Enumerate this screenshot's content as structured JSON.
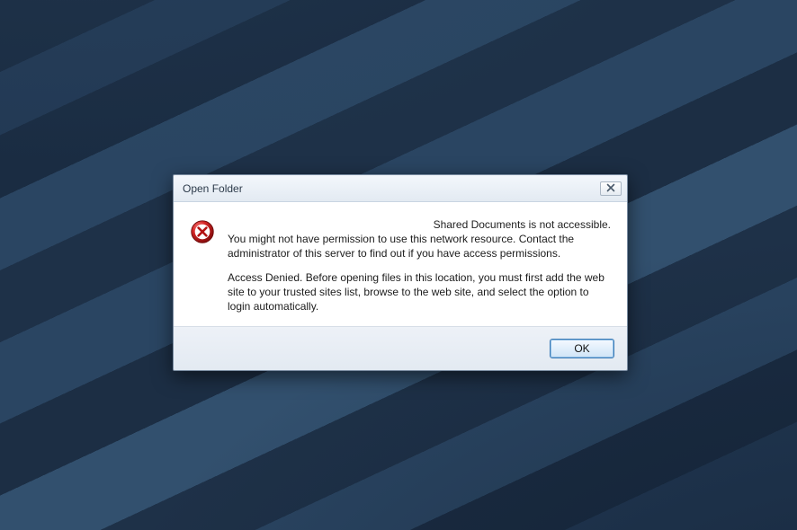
{
  "dialog": {
    "title": "Open Folder",
    "heading": "Shared Documents is not accessible.",
    "paragraph1": "You might not have permission to use this network resource. Contact the administrator of this server to find out if you have access permissions.",
    "paragraph2": "Access Denied. Before opening files in this location, you must first add the web site to your trusted sites list, browse to the web site, and select the option to login automatically.",
    "ok_label": "OK"
  },
  "icons": {
    "close": "close-icon",
    "error": "error-icon"
  }
}
